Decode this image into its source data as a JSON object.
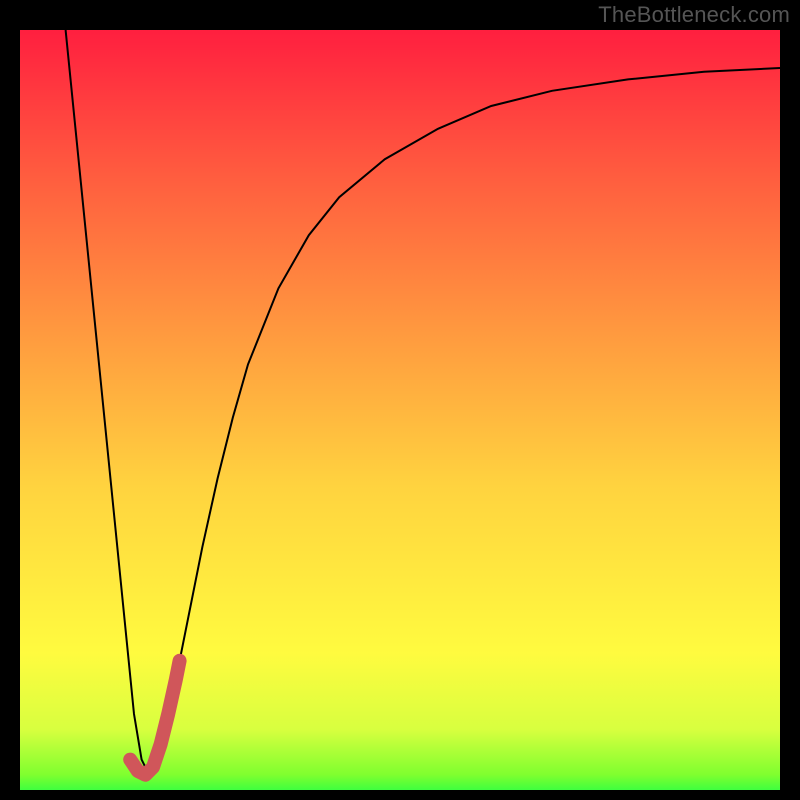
{
  "watermark": "TheBottleneck.com",
  "chart_data": {
    "type": "line",
    "title": "",
    "xlabel": "",
    "ylabel": "",
    "xlim": [
      0,
      100
    ],
    "ylim": [
      0,
      100
    ],
    "grid": false,
    "background_gradient": [
      {
        "pos": 0.0,
        "color": "#3fff3f"
      },
      {
        "pos": 0.02,
        "color": "#7fff2f"
      },
      {
        "pos": 0.08,
        "color": "#d8ff3f"
      },
      {
        "pos": 0.18,
        "color": "#fffb3f"
      },
      {
        "pos": 0.4,
        "color": "#ffd33f"
      },
      {
        "pos": 0.6,
        "color": "#ff9a3f"
      },
      {
        "pos": 0.8,
        "color": "#ff5f3f"
      },
      {
        "pos": 1.0,
        "color": "#ff1f3f"
      }
    ],
    "series": [
      {
        "name": "bottleneck-curve",
        "stroke": "#000000",
        "stroke_width": 2,
        "x": [
          6,
          8,
          10,
          12,
          14,
          15,
          16,
          17,
          18,
          20,
          22,
          24,
          26,
          28,
          30,
          34,
          38,
          42,
          48,
          55,
          62,
          70,
          80,
          90,
          100
        ],
        "y": [
          100,
          80,
          60,
          40,
          20,
          10,
          4,
          2,
          4,
          12,
          22,
          32,
          41,
          49,
          56,
          66,
          73,
          78,
          83,
          87,
          90,
          92,
          93.5,
          94.5,
          95
        ]
      },
      {
        "name": "highlight-hook",
        "stroke": "#d0565a",
        "stroke_width": 14,
        "linecap": "round",
        "x": [
          14.5,
          15.5,
          16.5,
          17.5,
          18.5,
          19.5,
          20.5,
          21.0
        ],
        "y": [
          4.0,
          2.5,
          2.0,
          3.0,
          6.0,
          10.0,
          14.5,
          17.0
        ]
      }
    ]
  }
}
